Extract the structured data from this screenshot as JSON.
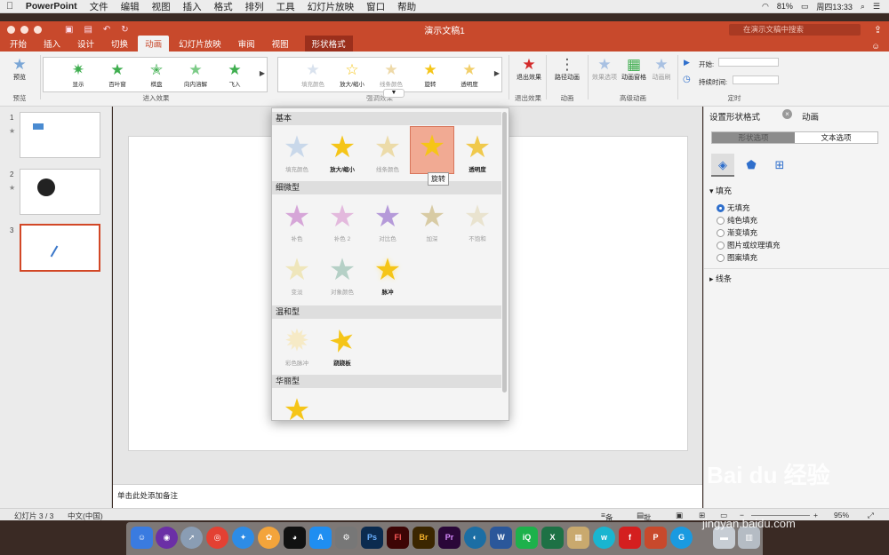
{
  "menubar": {
    "app": "PowerPoint",
    "items": [
      "文件",
      "编辑",
      "视图",
      "插入",
      "格式",
      "排列",
      "工具",
      "幻灯片放映",
      "窗口",
      "帮助"
    ],
    "battery": "81%",
    "clock": "周四13:33"
  },
  "titlebar": {
    "title": "演示文稿1",
    "search_placeholder": "在演示文稿中搜索"
  },
  "tabs": [
    "开始",
    "插入",
    "设计",
    "切换",
    "动画",
    "幻灯片放映",
    "审阅",
    "视图"
  ],
  "active_tab": "动画",
  "context_tab": "形状格式",
  "ribbon": {
    "preview": {
      "label": "预览",
      "group": "预览"
    },
    "entrance": {
      "group": "进入效果",
      "items": [
        "显示",
        "百叶窗",
        "棋盘",
        "向内溶解",
        "飞入"
      ]
    },
    "emphasis": {
      "group": "强调效果",
      "items": [
        "填充颜色",
        "放大/缩小",
        "线条颜色",
        "旋转",
        "透明度"
      ]
    },
    "exit": {
      "label": "退出效果",
      "group": "退出效果"
    },
    "path": {
      "label": "路径动画",
      "group": "动画"
    },
    "advanced": {
      "group": "高级动画",
      "items": [
        "效果选项",
        "动画窗格",
        "动画刷"
      ]
    },
    "timing": {
      "group": "定时",
      "start_label": "开始:",
      "duration_label": "持续时间:"
    }
  },
  "slides": [
    {
      "num": "1",
      "star": "★"
    },
    {
      "num": "2",
      "star": "★"
    },
    {
      "num": "3",
      "star": ""
    }
  ],
  "notes_placeholder": "单击此处添加备注",
  "dropdown": {
    "sections": {
      "basic": "基本",
      "subtle": "细微型",
      "moderate": "温和型",
      "exciting": "华丽型"
    },
    "basic": [
      "填充颜色",
      "放大/缩小",
      "线条颜色",
      "旋转",
      "透明度"
    ],
    "subtle": [
      "补色",
      "补色 2",
      "对比色",
      "加深",
      "不饱和",
      "变淡",
      "对象颜色",
      "脉冲"
    ],
    "moderate": [
      "彩色脉冲",
      "跷跷板"
    ],
    "tooltip": "旋转"
  },
  "right_panel": {
    "title": "设置形状格式",
    "tab2": "动画",
    "seg": [
      "形状选项",
      "文本选项"
    ],
    "fill_section": "填充",
    "fill_options": [
      "无填充",
      "纯色填充",
      "渐变填充",
      "图片或纹理填充",
      "图案填充"
    ],
    "line_section": "线条"
  },
  "status": {
    "slide_counter": "幻灯片 3 / 3",
    "language": "中文(中国)",
    "notes": "备注",
    "comments": "批注",
    "zoom": "95%"
  },
  "watermark": "Bai du 经验",
  "watermark_url": "jingyan.baidu.com",
  "colors": {
    "accent": "#c8492c",
    "selection": "#d24726",
    "star": "#f5c518"
  }
}
